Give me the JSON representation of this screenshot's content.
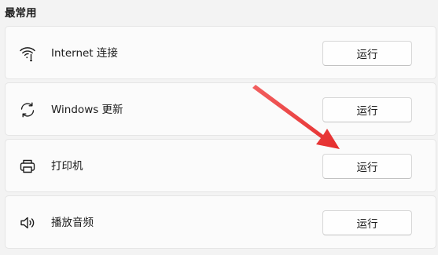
{
  "section": {
    "title": "最常用"
  },
  "items": [
    {
      "label": "Internet 连接",
      "icon": "wifi-icon",
      "button_label": "运行"
    },
    {
      "label": "Windows 更新",
      "icon": "sync-icon",
      "button_label": "运行"
    },
    {
      "label": "打印机",
      "icon": "printer-icon",
      "button_label": "运行"
    },
    {
      "label": "播放音频",
      "icon": "speaker-icon",
      "button_label": "运行"
    }
  ],
  "colors": {
    "background": "#f3f3f3",
    "card": "#fbfbfb",
    "arrow": "#ee3b3b"
  }
}
